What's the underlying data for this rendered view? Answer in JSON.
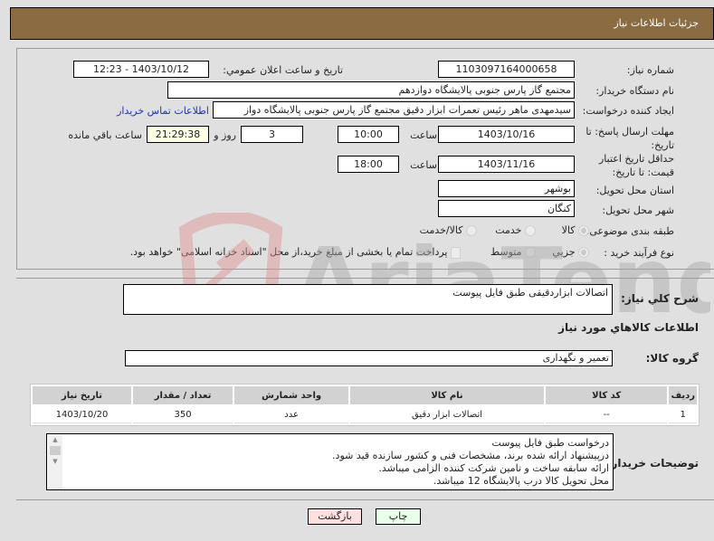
{
  "header": {
    "title": "جزئیات اطلاعات نیاز"
  },
  "form": {
    "need_number_label": "شماره نیاز:",
    "need_number": "1103097164000658",
    "announce_label": "تاریخ و ساعت اعلان عمومي:",
    "announce_value": "1403/10/12 - 12:23",
    "buyer_org_label": "نام دستگاه خریدار:",
    "buyer_org": "مجتمع گاز پارس جنوبی  پالایشگاه دوازدهم",
    "requester_label": "ایجاد کننده درخواست:",
    "requester": "سیدمهدی ماهر رئیس تعمرات ابزار دقیق مجتمع گاز پارس جنوبی  پالایشگاه دواز",
    "contact_link": "اطلاعات تماس خریدار",
    "deadline_label": "مهلت ارسال پاسخ: تا تاریخ:",
    "deadline_date": "1403/10/16",
    "time_label": "ساعت",
    "deadline_time": "10:00",
    "days_value": "3",
    "days_label": "روز و",
    "remaining_time": "21:29:38",
    "remaining_label": "ساعت باقي مانده",
    "validity_label": "حداقل تاریخ اعتبار قیمت: تا تاریخ:",
    "validity_date": "1403/11/16",
    "validity_time": "18:00",
    "province_label": "استان محل تحویل:",
    "province": "بوشهر",
    "city_label": "شهر محل تحویل:",
    "city": "کنگان",
    "category_label": "طبقه بندی موضوعی:",
    "category_options": [
      "کالا",
      "خدمت",
      "کالا/خدمت"
    ],
    "category_selected": "کالا",
    "process_label": "نوع فرآیند خرید :",
    "process_options": [
      "جزیي",
      "متوسط"
    ],
    "process_selected": "جزیي",
    "treasury_note": "پرداخت تمام یا بخشی از مبلغ خرید،از محل \"اسناد خزانه اسلامی\" خواهد بود."
  },
  "summary": {
    "label": "شرح کلي نیاز:",
    "value": "اتصالات ابزاردقیقی طبق فایل پیوست"
  },
  "goods": {
    "section_title": "اطلاعات کالاهاي مورد نیاز",
    "group_label": "گروه کالا:",
    "group_value": "تعمیر و نگهداری",
    "columns": [
      "ردیف",
      "کد کالا",
      "نام کالا",
      "واحد شمارش",
      "تعداد / مقدار",
      "تاریخ نیاز"
    ],
    "rows": [
      {
        "row": "1",
        "code": "--",
        "name": "اتصالات ابزار دقیق",
        "unit": "عدد",
        "qty": "350",
        "date": "1403/10/20"
      }
    ]
  },
  "buyer_notes": {
    "label": "توضیحات خریدار:",
    "lines": [
      "درخواست طبق فایل پیوست",
      "درپیشنهاد ارائه شده برند، مشخصات فنی و کشور سازنده قید شود.",
      "ارائه سابقه ساخت و تامین شرکت کننده الزامی میباشد.",
      "محل تحویل کالا درب پالایشگاه 12 میباشد."
    ]
  },
  "buttons": {
    "print": "چاپ",
    "back": "بازگشت"
  },
  "watermark": {
    "text": "AriaTender.neT"
  },
  "colors": {
    "header_bg": "#8b6c42",
    "print_bg": "#eaffea",
    "back_bg": "#ffe0e0",
    "link": "#2030c0"
  }
}
